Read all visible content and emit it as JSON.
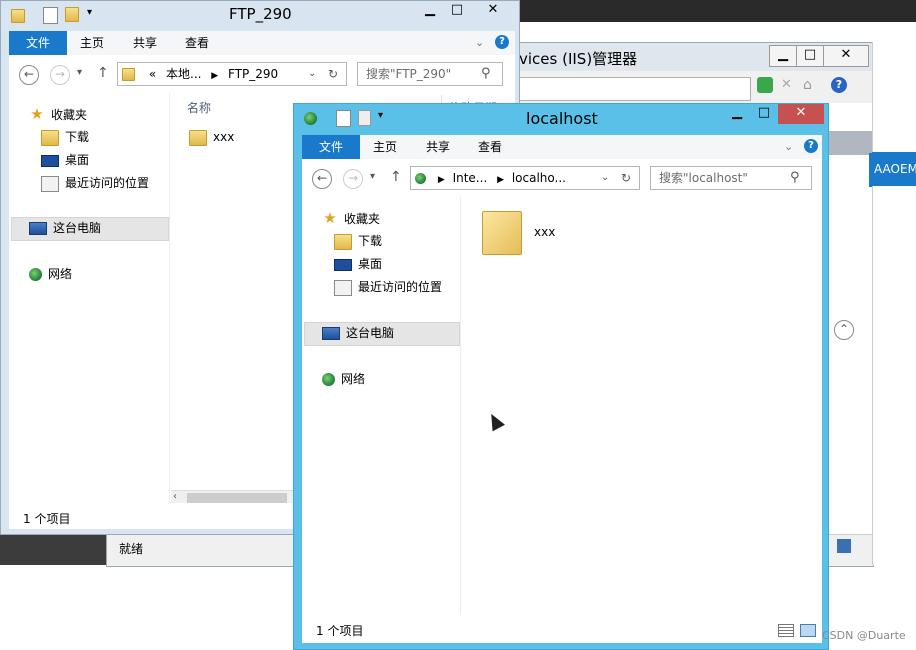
{
  "iis_window": {
    "title": "vices (IIS)管理器",
    "banner_text": "AAOEMI",
    "status": "就绪"
  },
  "ftp_window": {
    "title": "FTP_290",
    "ribbon_tabs": [
      "文件",
      "主页",
      "共享",
      "查看"
    ],
    "address_parts": [
      "«",
      "本地...",
      "FTP_290"
    ],
    "search_placeholder": "搜索\"FTP_290\"",
    "column_name": "名称",
    "column_modified": "修改日期",
    "nav": {
      "favorites": "收藏夹",
      "downloads": "下载",
      "desktop": "桌面",
      "recent": "最近访问的位置",
      "this_pc": "这台电脑",
      "network": "网络"
    },
    "files": [
      "xxx"
    ],
    "status": "1 个项目"
  },
  "localhost_window": {
    "title": "localhost",
    "ribbon_tabs": [
      "文件",
      "主页",
      "共享",
      "查看"
    ],
    "address_parts": [
      "Inte...",
      "localho..."
    ],
    "search_placeholder": "搜索\"localhost\"",
    "nav": {
      "favorites": "收藏夹",
      "downloads": "下载",
      "desktop": "桌面",
      "recent": "最近访问的位置",
      "this_pc": "这台电脑",
      "network": "网络"
    },
    "files": [
      "xxx"
    ],
    "status": "1 个项目"
  },
  "watermark": "CSDN @Duarte",
  "colors": {
    "accent_blue": "#1979ca",
    "localhost_frame": "#5ac0e8",
    "ftp_frame": "#d8e4f0",
    "close_red": "#c75050",
    "selected_nav": "#e5e5e5"
  }
}
